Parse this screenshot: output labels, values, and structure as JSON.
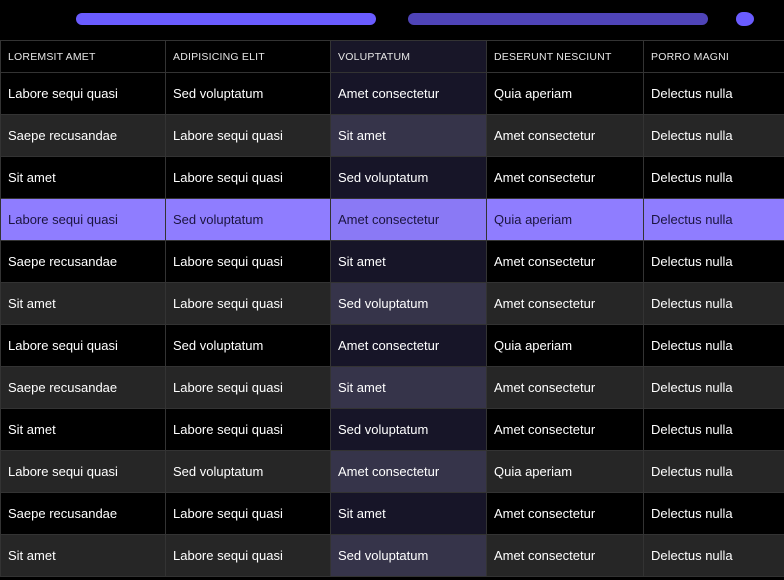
{
  "colors": {
    "accent": "#6a5cff",
    "accent_dark": "#4f44b8",
    "selected_row": "#8f7dff"
  },
  "scrollbar": {
    "thumb_icon": "scroll-thumb-icon"
  },
  "table": {
    "columns": [
      "LOREMSIT AMET",
      "ADIPISICING ELIT",
      "VOLUPTATUM",
      "DESERUNT NESCIUNT",
      "PORRO MAGNI"
    ],
    "rows": [
      [
        "Labore sequi quasi",
        "Sed voluptatum",
        "Amet consectetur",
        "Quia aperiam",
        "Delectus nulla"
      ],
      [
        "Saepe recusandae",
        "Labore sequi quasi",
        "Sit amet",
        "Amet consectetur",
        "Delectus nulla"
      ],
      [
        "Sit amet",
        "Labore sequi quasi",
        "Sed voluptatum",
        "Amet consectetur",
        "Delectus nulla"
      ],
      [
        "Labore sequi quasi",
        "Sed voluptatum",
        "Amet consectetur",
        "Quia aperiam",
        "Delectus nulla"
      ],
      [
        "Saepe recusandae",
        "Labore sequi quasi",
        "Sit amet",
        "Amet consectetur",
        "Delectus nulla"
      ],
      [
        "Sit amet",
        "Labore sequi quasi",
        "Sed voluptatum",
        "Amet consectetur",
        "Delectus nulla"
      ],
      [
        "Labore sequi quasi",
        "Sed voluptatum",
        "Amet consectetur",
        "Quia aperiam",
        "Delectus nulla"
      ],
      [
        "Saepe recusandae",
        "Labore sequi quasi",
        "Sit amet",
        "Amet consectetur",
        "Delectus nulla"
      ],
      [
        "Sit amet",
        "Labore sequi quasi",
        "Sed voluptatum",
        "Amet consectetur",
        "Delectus nulla"
      ],
      [
        "Labore sequi quasi",
        "Sed voluptatum",
        "Amet consectetur",
        "Quia aperiam",
        "Delectus nulla"
      ],
      [
        "Saepe recusandae",
        "Labore sequi quasi",
        "Sit amet",
        "Amet consectetur",
        "Delectus nulla"
      ],
      [
        "Sit amet",
        "Labore sequi quasi",
        "Sed voluptatum",
        "Amet consectetur",
        "Delectus nulla"
      ]
    ]
  }
}
